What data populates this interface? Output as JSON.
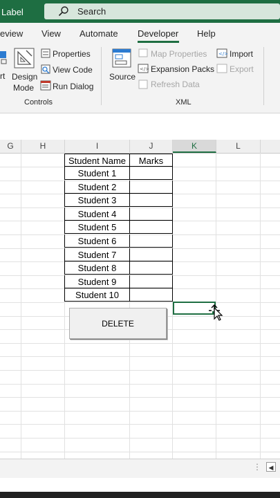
{
  "title_bar": {
    "doc_label": "Label",
    "search_text": "Search"
  },
  "tabs": [
    "eview",
    "View",
    "Automate",
    "Developer",
    "Help"
  ],
  "ribbon": {
    "controls": {
      "insert_partial": "rt",
      "design_mode_line1": "Design",
      "design_mode_line2": "Mode",
      "properties": "Properties",
      "view_code": "View Code",
      "run_dialog": "Run Dialog",
      "group_label": "Controls"
    },
    "xml": {
      "source": "Source",
      "map_properties": "Map Properties",
      "expansion_packs": "Expansion Packs",
      "refresh_data": "Refresh Data",
      "import": "Import",
      "export": "Export",
      "group_label": "XML"
    }
  },
  "columns": [
    "G",
    "H",
    "I",
    "J",
    "K",
    "L"
  ],
  "table": {
    "headers": [
      "Student Name",
      "Marks"
    ],
    "rows": [
      "Student 1",
      "Student 2",
      "Student 3",
      "Student 4",
      "Student 5",
      "Student 6",
      "Student 7",
      "Student 8",
      "Student 9",
      "Student 10"
    ]
  },
  "delete_button_label": "DELETE",
  "colors": {
    "accent": "#1e6e42",
    "ribbon_bg": "#f3f3f3"
  }
}
